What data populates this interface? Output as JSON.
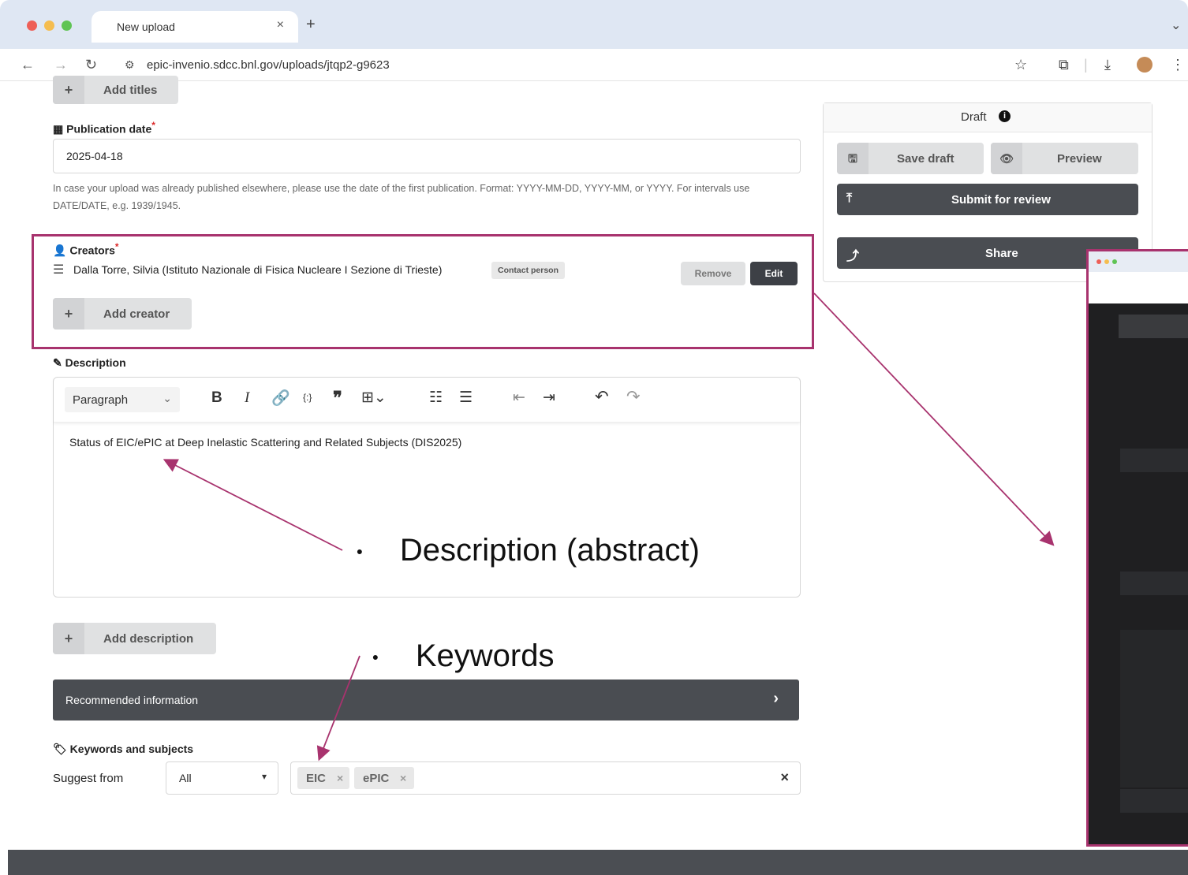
{
  "browser": {
    "tab_title": "New upload",
    "tab_close": "×",
    "new_tab": "+",
    "url": "epic-invenio.sdcc.bnl.gov/uploads/jtqp2-g9623",
    "menu_chevron": "⌄"
  },
  "form": {
    "add_titles": "Add titles",
    "publication_date": {
      "label": "Publication date",
      "required_mark": "*",
      "value": "2025-04-18",
      "help": "In case your upload was already published elsewhere, please use the date of the first publication. Format: YYYY-MM-DD, YYYY-MM, or YYYY. For intervals use DATE/DATE, e.g. 1939/1945."
    },
    "creators": {
      "label": "Creators",
      "required_mark": "*",
      "items": [
        {
          "name": "Dalla Torre, Silvia (Istituto Nazionale di Fisica Nucleare I Sezione di Trieste)",
          "role": "Contact person"
        }
      ],
      "remove_label": "Remove",
      "edit_label": "Edit",
      "add_label": "Add creator"
    },
    "description": {
      "label": "Description",
      "format_select": "Paragraph",
      "content": "Status of EIC/ePIC at Deep Inelastic Scattering and Related Subjects (DIS2025)",
      "add_label": "Add description"
    },
    "recommended": {
      "label": "Recommended information"
    },
    "keywords": {
      "label": "Keywords and subjects",
      "suggest_label": "Suggest from",
      "suggest_value": "All",
      "tags": [
        "EIC",
        "ePIC"
      ],
      "clear": "×"
    }
  },
  "sidebar": {
    "status": "Draft",
    "save_draft": "Save draft",
    "preview": "Preview",
    "submit": "Submit for review",
    "share": "Share"
  },
  "annotations": {
    "description_label": "Description (abstract)",
    "keywords_label": "Keywords"
  },
  "colors": {
    "annotation": "#a8336e",
    "dark_button": "#4a4d52",
    "tab_bar": "#dfe7f3"
  }
}
